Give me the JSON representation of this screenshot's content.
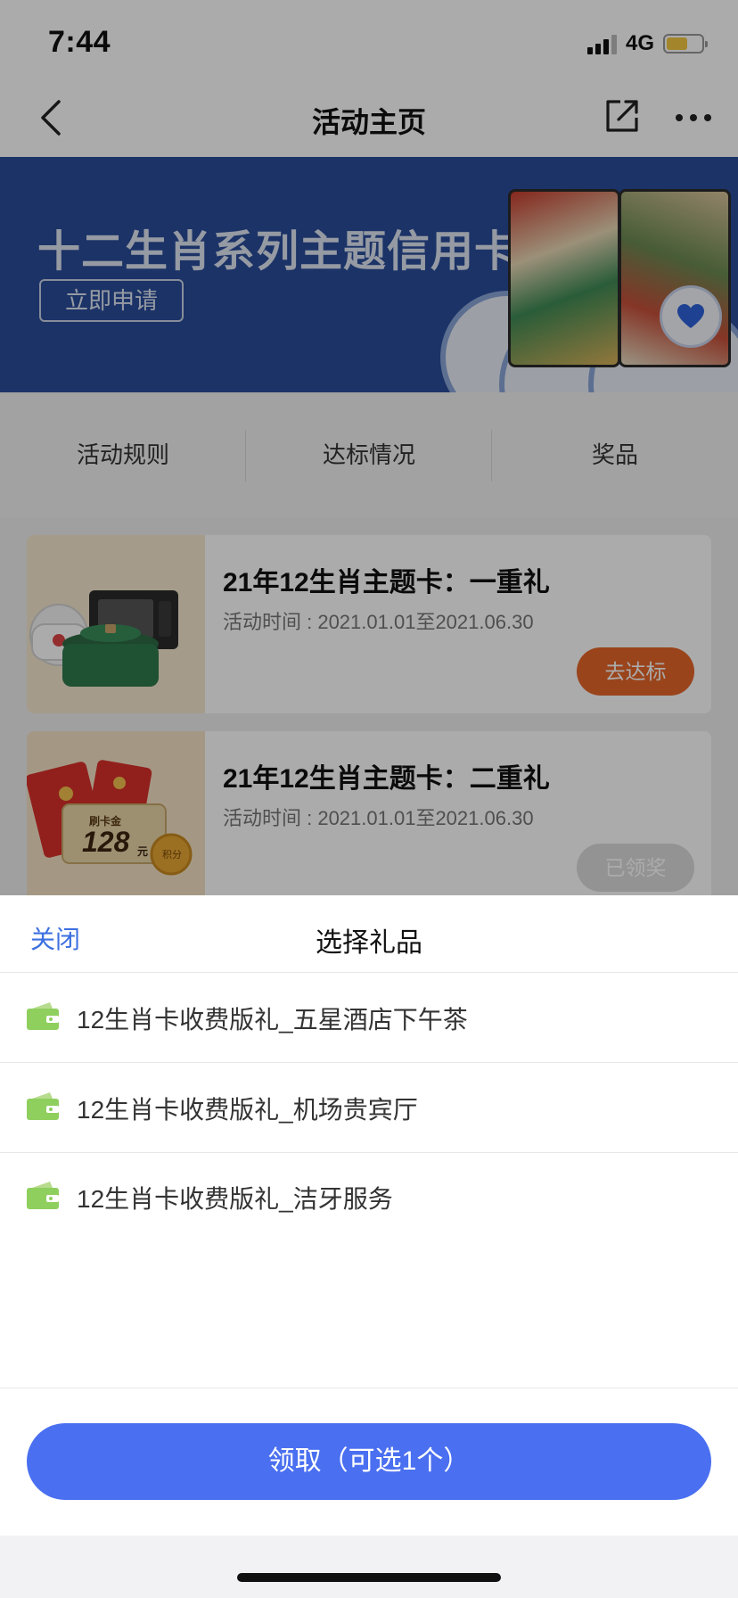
{
  "status": {
    "time": "7:44",
    "network": "4G",
    "battery_level": 0.6
  },
  "nav": {
    "title": "活动主页",
    "back_icon": "chevron-left-icon",
    "share_icon": "share-icon",
    "more_icon": "more-dots-icon"
  },
  "banner": {
    "title": "十二生肖系列主题信用卡",
    "button": "立即申请"
  },
  "tabs": [
    {
      "label": "活动规则"
    },
    {
      "label": "达标情况"
    },
    {
      "label": "奖品"
    }
  ],
  "activities": [
    {
      "title": "21年12生肖主题卡：一重礼",
      "time": "活动时间 : 2021.01.01至2021.06.30",
      "button": "去达标",
      "button_state": "active"
    },
    {
      "title": "21年12生肖主题卡：二重礼",
      "time": "活动时间 : 2021.01.01至2021.06.30",
      "button": "已领奖",
      "button_state": "disabled",
      "image_text": {
        "label": "刷卡金",
        "amount": "128",
        "unit": "元",
        "badge": "积分"
      }
    }
  ],
  "sheet": {
    "close": "关闭",
    "title": "选择礼品",
    "options": [
      {
        "label": "12生肖卡收费版礼_五星酒店下午茶",
        "icon": "wallet-icon"
      },
      {
        "label": "12生肖卡收费版礼_机场贵宾厅",
        "icon": "wallet-icon"
      },
      {
        "label": "12生肖卡收费版礼_洁牙服务",
        "icon": "wallet-icon"
      }
    ],
    "claim_button": "领取（可选1个）"
  },
  "colors": {
    "accent": "#4a6ff0",
    "link": "#3d6fe0",
    "orange": "#e6662a",
    "banner": "#2a4c9a"
  }
}
